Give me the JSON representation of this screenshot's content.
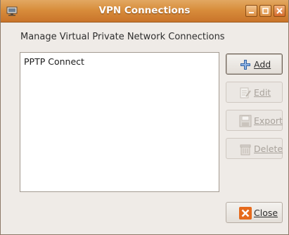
{
  "window": {
    "title": "VPN Connections"
  },
  "main": {
    "heading": "Manage Virtual Private Network Connections",
    "connections": [
      {
        "name": "PPTP Connect"
      }
    ]
  },
  "buttons": {
    "add": {
      "label": "Add",
      "icon": "plus-icon",
      "enabled": true
    },
    "edit": {
      "label": "Edit",
      "icon": "edit-document-icon",
      "enabled": false
    },
    "export": {
      "label": "Export",
      "icon": "floppy-disk-icon",
      "enabled": false
    },
    "delete": {
      "label": "Delete",
      "icon": "trash-icon",
      "enabled": false
    },
    "close": {
      "label": "Close",
      "icon": "close-x-icon",
      "enabled": true
    }
  },
  "colors": {
    "titlebar": "#d88d3c",
    "window_bg": "#efebe7",
    "close_icon": "#e56a1c",
    "add_icon": "#3465a4"
  }
}
